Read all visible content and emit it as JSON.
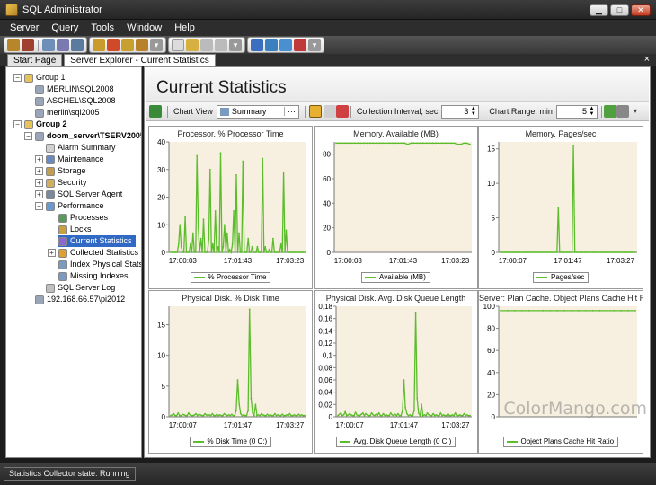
{
  "window": {
    "title": "SQL Administrator"
  },
  "menu": [
    "Server",
    "Query",
    "Tools",
    "Window",
    "Help"
  ],
  "tabs": [
    {
      "label": "Start Page",
      "active": false
    },
    {
      "label": "Server Explorer - Current Statistics",
      "active": true
    }
  ],
  "tab_close": "×",
  "tree": [
    {
      "label": "Group 1",
      "bold": false,
      "icon": "folder-icon",
      "level": 0,
      "expander": "-"
    },
    {
      "label": "MERLIN\\SQL2008",
      "bold": false,
      "icon": "server-icon",
      "level": 1
    },
    {
      "label": "ASCHEL\\SQL2008",
      "bold": false,
      "icon": "server-icon",
      "level": 1
    },
    {
      "label": "merlin\\sql2005",
      "bold": false,
      "icon": "server-icon",
      "level": 1
    },
    {
      "label": "Group 2",
      "bold": true,
      "icon": "folder-icon",
      "level": 0,
      "expander": "-"
    },
    {
      "label": "doom_server\\TSERV2005",
      "bold": true,
      "icon": "server-icon",
      "level": 1,
      "expander": "-"
    },
    {
      "label": "Alarm Summary",
      "bold": false,
      "icon": "alarm-icon",
      "level": 2
    },
    {
      "label": "Maintenance",
      "bold": false,
      "icon": "maintenance-icon",
      "level": 2,
      "expander": "+"
    },
    {
      "label": "Storage",
      "bold": false,
      "icon": "storage-icon",
      "level": 2,
      "expander": "+"
    },
    {
      "label": "Security",
      "bold": false,
      "icon": "security-icon",
      "level": 2,
      "expander": "+"
    },
    {
      "label": "SQL Server Agent",
      "bold": false,
      "icon": "agent-icon",
      "level": 2,
      "expander": "+"
    },
    {
      "label": "Performance",
      "bold": false,
      "icon": "performance-icon",
      "level": 2,
      "expander": "-"
    },
    {
      "label": "Processes",
      "bold": false,
      "icon": "processes-icon",
      "level": 3
    },
    {
      "label": "Locks",
      "bold": false,
      "icon": "lock-icon",
      "level": 3
    },
    {
      "label": "Current Statistics",
      "bold": false,
      "icon": "statistics-icon",
      "level": 3,
      "selected": true
    },
    {
      "label": "Collected Statistics",
      "bold": false,
      "icon": "collected-icon",
      "level": 3,
      "expander": "+"
    },
    {
      "label": "Index Physical Stats",
      "bold": false,
      "icon": "index-icon",
      "level": 3
    },
    {
      "label": "Missing Indexes",
      "bold": false,
      "icon": "index-icon",
      "level": 3
    },
    {
      "label": "SQL Server Log",
      "bold": false,
      "icon": "log-icon",
      "level": 2
    },
    {
      "label": "192.168.66.57\\pi2012",
      "bold": false,
      "icon": "server-icon",
      "level": 1
    }
  ],
  "content": {
    "title": "Current Statistics",
    "chart_view_label": "Chart View",
    "chart_view_value": "Summary",
    "interval_label": "Collection Interval, sec",
    "interval_value": "3",
    "range_label": "Chart Range, min",
    "range_value": "5",
    "combo_more": "···"
  },
  "status": {
    "text": "Statistics Collector state: Running"
  },
  "watermark": "ColorMango.com",
  "colors": {
    "series": "#5bbd2b",
    "plot_bg": "#f7efdf"
  },
  "chart_data": [
    {
      "type": "line",
      "title": "Processor. % Processor Time",
      "legend": "% Processor Time",
      "x_ticks": [
        "17:00:03",
        "17:01:43",
        "17:03:23"
      ],
      "ylim": [
        0,
        40
      ],
      "y_ticks": [
        0,
        10,
        20,
        30,
        40
      ],
      "values": [
        0,
        0,
        0,
        0,
        0,
        0,
        3,
        10,
        2,
        0,
        0,
        13,
        0,
        0,
        0,
        3,
        0,
        7,
        0,
        0,
        35,
        9,
        0,
        5,
        0,
        12,
        0,
        0,
        0,
        5,
        30,
        0,
        3,
        0,
        15,
        0,
        2,
        0,
        36,
        0,
        2,
        10,
        0,
        7,
        0,
        1,
        0,
        3,
        15,
        0,
        28,
        0,
        7,
        0,
        0,
        33,
        0,
        0,
        0,
        5,
        0,
        0,
        2,
        0,
        0,
        0,
        2,
        0,
        0,
        0,
        34,
        0,
        2,
        0,
        0,
        1,
        0,
        0,
        5,
        0,
        0,
        0,
        0,
        0,
        3,
        0,
        29,
        0,
        8,
        0,
        0,
        0,
        0,
        0,
        0,
        0,
        0,
        0,
        0,
        0,
        0,
        0,
        0
      ]
    },
    {
      "type": "line",
      "title": "Memory. Available (MB)",
      "legend": "Available (MB)",
      "x_ticks": [
        "17:00:03",
        "17:01:43",
        "17:03:23"
      ],
      "ylim": [
        0,
        90
      ],
      "y_ticks": [
        0,
        20,
        40,
        60,
        80
      ],
      "values": [
        89,
        89,
        89,
        89,
        89,
        89,
        89,
        89,
        89,
        89,
        89,
        89,
        89,
        89,
        89,
        89,
        89,
        89,
        89,
        89,
        89,
        89,
        89,
        88,
        89,
        89,
        89,
        89,
        89,
        89,
        89,
        89,
        89,
        89,
        89,
        89,
        89,
        89,
        89,
        88,
        88,
        89,
        89,
        88
      ]
    },
    {
      "type": "line",
      "title": "Memory. Pages/sec",
      "legend": "Pages/sec",
      "x_ticks": [
        "17:00:07",
        "17:01:47",
        "17:03:27"
      ],
      "ylim": [
        0,
        16
      ],
      "y_ticks": [
        0,
        5,
        10,
        15
      ],
      "values": [
        0,
        0,
        0,
        0,
        0,
        0,
        0,
        0,
        0,
        0,
        0,
        0,
        0,
        0,
        0,
        0,
        0,
        0,
        0,
        0,
        0,
        0,
        0,
        0,
        0,
        0,
        0,
        0,
        0,
        0,
        0,
        0,
        0,
        0,
        0,
        0,
        0,
        0,
        0,
        0,
        0,
        0,
        6.5,
        0,
        0,
        0,
        0,
        0,
        0,
        0,
        0,
        0,
        0,
        15.5,
        0,
        0,
        0,
        0,
        0,
        0,
        0,
        0,
        0,
        0,
        0,
        0,
        0,
        0,
        0,
        0,
        0,
        0,
        0,
        0,
        0,
        0,
        0,
        0,
        0,
        0,
        0,
        0,
        0,
        0,
        0,
        0,
        0,
        0,
        0,
        0,
        0,
        0,
        0,
        0,
        0,
        0,
        0,
        0,
        0
      ]
    },
    {
      "type": "line",
      "title": "Physical Disk. % Disk Time",
      "legend": "% Disk Time (0 C:)",
      "x_ticks": [
        "17:00:07",
        "17:01:47",
        "17:03:27"
      ],
      "ylim": [
        0,
        18
      ],
      "y_ticks": [
        0,
        5,
        10,
        15
      ],
      "values": [
        0.2,
        0.3,
        0.5,
        0.2,
        0.2,
        0.6,
        0.2,
        0.2,
        0.4,
        0.3,
        0.2,
        0.2,
        0.6,
        0.3,
        0.2,
        0.2,
        0.3,
        0.5,
        0.2,
        0.4,
        0.3,
        0.2,
        0.2,
        0.5,
        0.3,
        0.2,
        0.3,
        0.2,
        0.5,
        0.2,
        0.2,
        0.4,
        0.2,
        0.3,
        0.2,
        0.2,
        0.5,
        0.3,
        0.2,
        0.3,
        0.2,
        0.4,
        0.2,
        0.2,
        1,
        6,
        2,
        0.5,
        0.2,
        0.3,
        0.2,
        0.2,
        1,
        17.5,
        3,
        0.6,
        0.2,
        2,
        0.2,
        0.3,
        0.2,
        0.5,
        0.3,
        0.2,
        0.2,
        0.4,
        0.2,
        0.3,
        0.2,
        0.2,
        0.5,
        0.2,
        0.3,
        0.2,
        0.2,
        0.4,
        0.2,
        0.2,
        0.3,
        0.2,
        0.5,
        0.2,
        0.2,
        0.3,
        0.2,
        0.2,
        0.4,
        0.2,
        0.3,
        0.2,
        0.2
      ]
    },
    {
      "type": "line",
      "title": "Physical Disk. Avg. Disk Queue Length",
      "legend": "Avg. Disk Queue Length (0 C:)",
      "x_ticks": [
        "17:00:07",
        "17:01:47",
        "17:03:27"
      ],
      "ylim": [
        0,
        0.18
      ],
      "y_ticks": [
        "0",
        "0,02",
        "0,04",
        "0,06",
        "0,08",
        "0,1",
        "0,12",
        "0,14",
        "0,16",
        "0,18"
      ],
      "y_tick_values": [
        0,
        0.02,
        0.04,
        0.06,
        0.08,
        0.1,
        0.12,
        0.14,
        0.16,
        0.18
      ],
      "values": [
        0.002,
        0.004,
        0.006,
        0.002,
        0.003,
        0.008,
        0.002,
        0.003,
        0.005,
        0.003,
        0.002,
        0.002,
        0.007,
        0.003,
        0.002,
        0.002,
        0.004,
        0.006,
        0.002,
        0.005,
        0.003,
        0.002,
        0.002,
        0.006,
        0.003,
        0.002,
        0.004,
        0.002,
        0.006,
        0.002,
        0.002,
        0.005,
        0.002,
        0.003,
        0.002,
        0.002,
        0.006,
        0.003,
        0.002,
        0.004,
        0.002,
        0.005,
        0.002,
        0.002,
        0.01,
        0.06,
        0.015,
        0.005,
        0.002,
        0.003,
        0.002,
        0.002,
        0.01,
        0.17,
        0.03,
        0.006,
        0.002,
        0.02,
        0.002,
        0.003,
        0.002,
        0.006,
        0.003,
        0.002,
        0.002,
        0.005,
        0.002,
        0.003,
        0.002,
        0.002,
        0.006,
        0.002,
        0.003,
        0.002,
        0.002,
        0.005,
        0.002,
        0.002,
        0.003,
        0.002,
        0.006,
        0.002,
        0.002,
        0.003,
        0.002,
        0.002,
        0.005,
        0.002,
        0.003,
        0.002,
        0.002
      ]
    },
    {
      "type": "line",
      "title": "Server: Plan Cache. Object Plans Cache Hit Ratio",
      "legend": "Object Plans Cache Hit Ratio",
      "x_ticks": [],
      "ylim": [
        0,
        100
      ],
      "y_ticks": [
        0,
        20,
        40,
        60,
        80,
        100
      ],
      "values": [
        96,
        96,
        96,
        96,
        96,
        96,
        96,
        96,
        96,
        96,
        96,
        96,
        96,
        96,
        96,
        96,
        96,
        96,
        96,
        96
      ]
    }
  ]
}
